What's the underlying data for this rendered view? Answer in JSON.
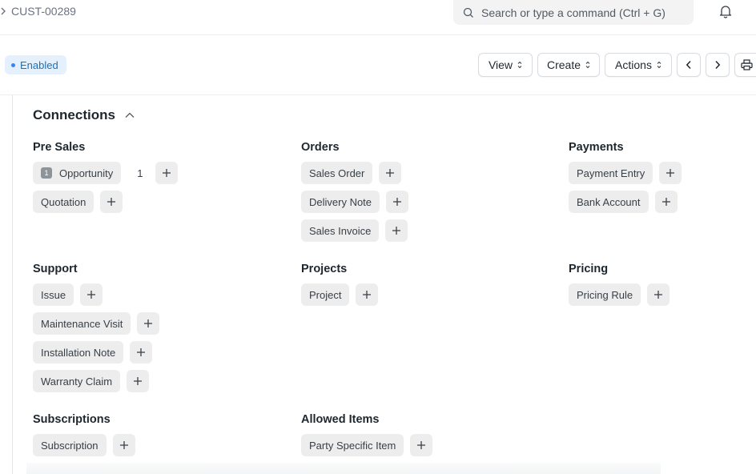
{
  "breadcrumb": {
    "record_id": "CUST-00289"
  },
  "search": {
    "placeholder": "Search or type a command (Ctrl + G)"
  },
  "status_badge": "Enabled",
  "toolbar": {
    "view": "View",
    "create": "Create",
    "actions": "Actions"
  },
  "connections": {
    "title": "Connections",
    "groups": [
      {
        "title": "Pre Sales",
        "items": [
          {
            "label": "Opportunity",
            "count": "1"
          },
          {
            "label": "Quotation"
          }
        ]
      },
      {
        "title": "Orders",
        "items": [
          {
            "label": "Sales Order"
          },
          {
            "label": "Delivery Note"
          },
          {
            "label": "Sales Invoice"
          }
        ]
      },
      {
        "title": "Payments",
        "items": [
          {
            "label": "Payment Entry"
          },
          {
            "label": "Bank Account"
          }
        ]
      },
      {
        "title": "Support",
        "items": [
          {
            "label": "Issue"
          },
          {
            "label": "Maintenance Visit"
          },
          {
            "label": "Installation Note"
          },
          {
            "label": "Warranty Claim"
          }
        ]
      },
      {
        "title": "Projects",
        "items": [
          {
            "label": "Project"
          }
        ]
      },
      {
        "title": "Pricing",
        "items": [
          {
            "label": "Pricing Rule"
          }
        ]
      },
      {
        "title": "Subscriptions",
        "items": [
          {
            "label": "Subscription"
          }
        ]
      },
      {
        "title": "Allowed Items",
        "items": [
          {
            "label": "Party Specific Item"
          }
        ]
      }
    ]
  },
  "icons": {
    "search": "search-icon",
    "bell": "bell-icon",
    "prev": "chevron-left-icon",
    "next": "chevron-right-icon",
    "print": "printer-icon",
    "collapse": "chevron-up-icon",
    "add": "plus-icon"
  },
  "colors": {
    "badge_bg": "#e4f1fc",
    "badge_text": "#1f6fb5",
    "pill_bg": "#ededed"
  }
}
